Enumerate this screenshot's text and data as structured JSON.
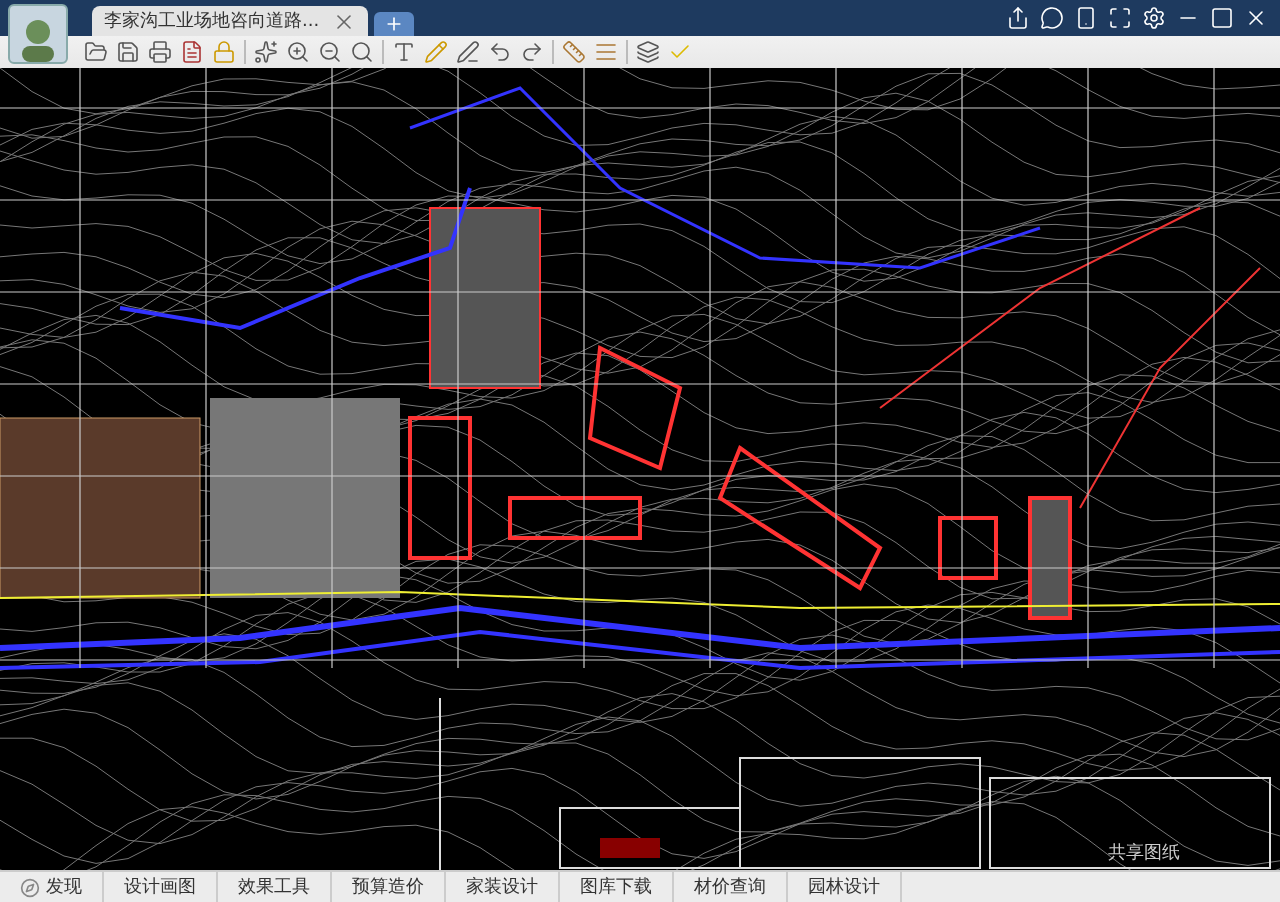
{
  "document_tab": {
    "title": "李家沟工业场地咨向道路...",
    "selected": true
  },
  "bottom_tabs": [
    {
      "label": "发现",
      "kind": "icon"
    },
    {
      "label": "设计画图",
      "kind": "plain"
    },
    {
      "label": "效果工具",
      "kind": "plain"
    },
    {
      "label": "预算造价",
      "kind": "plain"
    },
    {
      "label": "家装设计",
      "kind": "plain"
    },
    {
      "label": "图库下载",
      "kind": "plain"
    },
    {
      "label": "材价查询",
      "kind": "plain"
    },
    {
      "label": "园林设计",
      "kind": "plain"
    }
  ],
  "share_label": "共享图纸"
}
